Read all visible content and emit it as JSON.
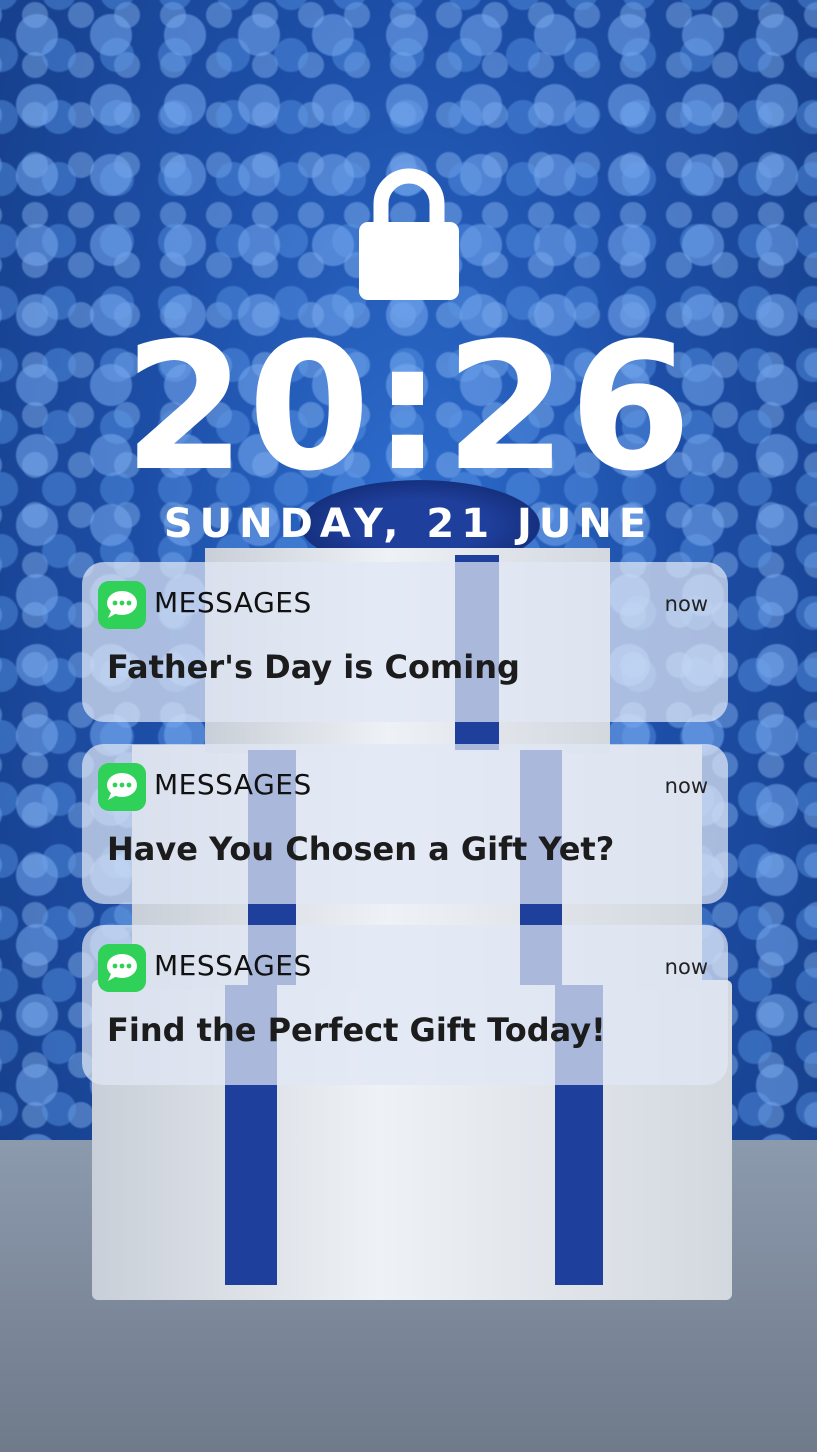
{
  "lockscreen": {
    "time": "20:26",
    "date": "SUNDAY, 21 JUNE",
    "lock_icon": "padlock-icon"
  },
  "notifications": [
    {
      "app": "MESSAGES",
      "time": "now",
      "body": "Father's Day is Coming",
      "icon": "messages-app-icon"
    },
    {
      "app": "MESSAGES",
      "time": "now",
      "body": "Have You Chosen a Gift Yet?",
      "icon": "messages-app-icon"
    },
    {
      "app": "MESSAGES",
      "time": "now",
      "body": "Find the Perfect Gift Today!",
      "icon": "messages-app-icon"
    }
  ],
  "colors": {
    "background": "#1d4fa8",
    "notification_bg": "#e1e8f5",
    "messages_green": "#2fd158",
    "ribbon": "#1f3f9c"
  }
}
